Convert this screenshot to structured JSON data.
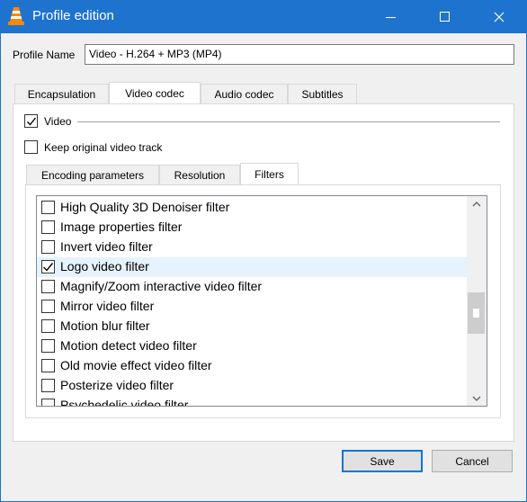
{
  "window": {
    "title": "Profile edition",
    "icon": "vlc-cone-icon"
  },
  "profile": {
    "label": "Profile Name",
    "value": "Video - H.264 + MP3 (MP4)"
  },
  "main_tabs": [
    {
      "label": "Encapsulation",
      "active": false
    },
    {
      "label": "Video codec",
      "active": true
    },
    {
      "label": "Audio codec",
      "active": false
    },
    {
      "label": "Subtitles",
      "active": false
    }
  ],
  "video": {
    "video_checkbox_label": "Video",
    "video_checked": true,
    "keep_track_label": "Keep original video track",
    "keep_track_checked": false
  },
  "sub_tabs": [
    {
      "label": "Encoding parameters",
      "active": false
    },
    {
      "label": "Resolution",
      "active": false
    },
    {
      "label": "Filters",
      "active": true
    }
  ],
  "filters": [
    {
      "label": "High Quality 3D Denoiser filter",
      "checked": false,
      "selected": false
    },
    {
      "label": "Image properties filter",
      "checked": false,
      "selected": false
    },
    {
      "label": "Invert video filter",
      "checked": false,
      "selected": false
    },
    {
      "label": "Logo video filter",
      "checked": true,
      "selected": true
    },
    {
      "label": "Magnify/Zoom interactive video filter",
      "checked": false,
      "selected": false
    },
    {
      "label": "Mirror video filter",
      "checked": false,
      "selected": false
    },
    {
      "label": "Motion blur filter",
      "checked": false,
      "selected": false
    },
    {
      "label": "Motion detect video filter",
      "checked": false,
      "selected": false
    },
    {
      "label": "Old movie effect video filter",
      "checked": false,
      "selected": false
    },
    {
      "label": "Posterize video filter",
      "checked": false,
      "selected": false
    },
    {
      "label": "Psychedelic video filter",
      "checked": false,
      "selected": false
    }
  ],
  "buttons": {
    "save": "Save",
    "cancel": "Cancel"
  },
  "colors": {
    "titlebar": "#1e73cf",
    "selection": "#e5f3ff",
    "default_button_border": "#0078d7"
  }
}
